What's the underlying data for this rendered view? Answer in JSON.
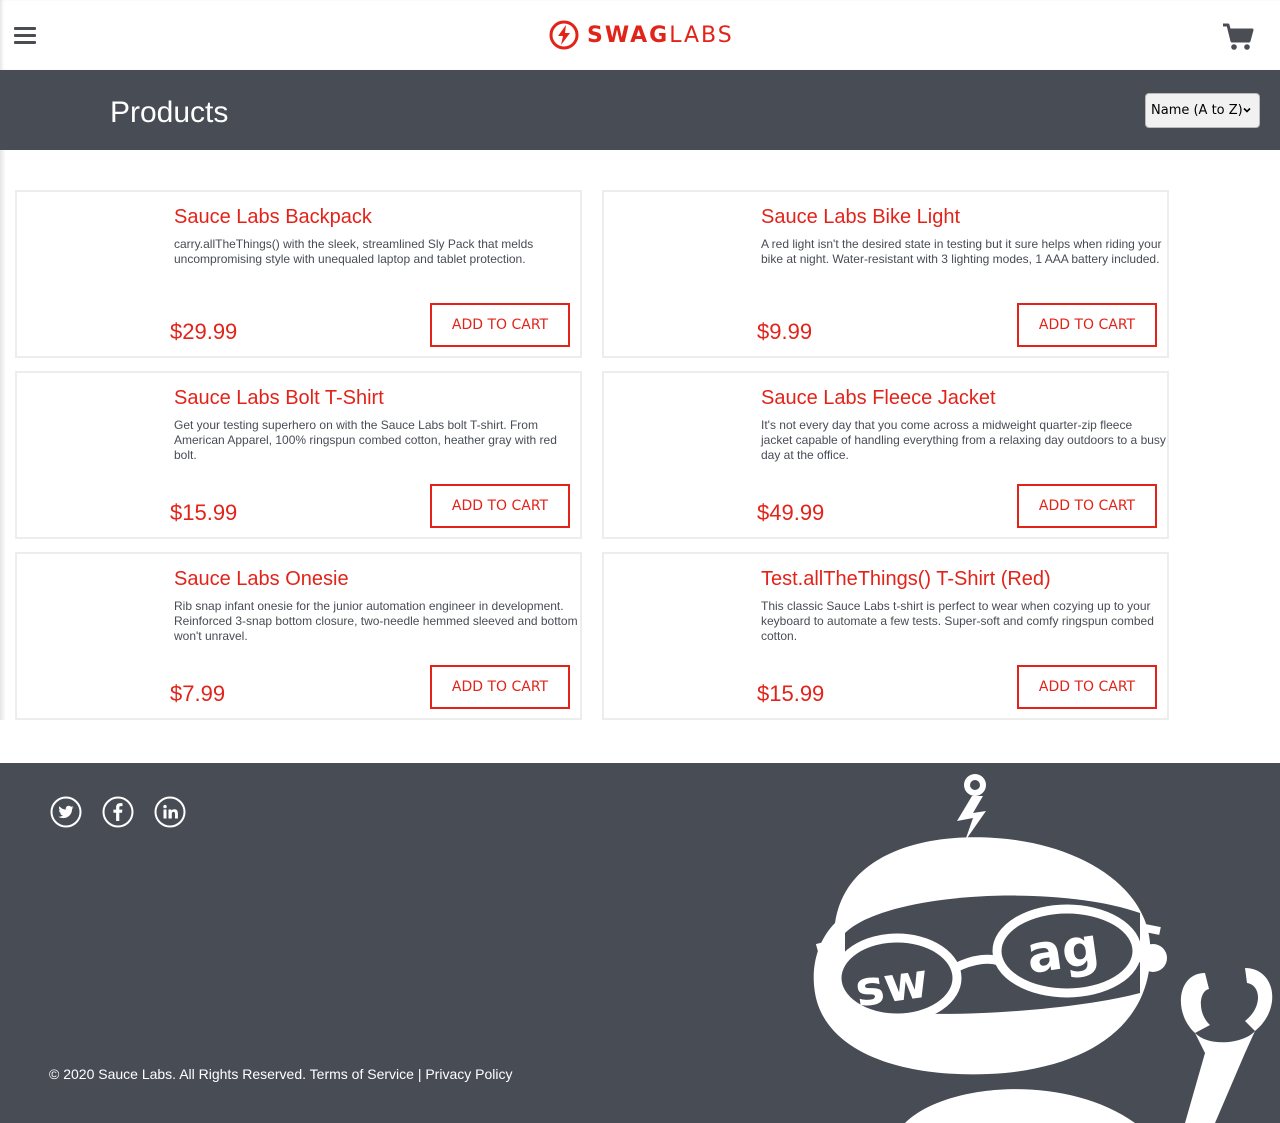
{
  "header": {
    "logo_bold": "SWAG",
    "logo_light": "LABS",
    "icons": {
      "menu": "hamburger-menu-icon",
      "cart": "shopping-cart-icon",
      "logo": "bolt-logo-icon"
    }
  },
  "subheader": {
    "title": "Products",
    "sort_selected": "Name (A to Z)"
  },
  "products": [
    {
      "name": "Sauce Labs Backpack",
      "description": "carry.allTheThings() with the sleek, streamlined Sly Pack that melds uncompromising style with unequaled laptop and tablet protection.",
      "price": "$29.99",
      "button": "ADD TO CART"
    },
    {
      "name": "Sauce Labs Bike Light",
      "description": "A red light isn't the desired state in testing but it sure helps when riding your bike at night. Water-resistant with 3 lighting modes, 1 AAA battery included.",
      "price": "$9.99",
      "button": "ADD TO CART"
    },
    {
      "name": "Sauce Labs Bolt T-Shirt",
      "description": "Get your testing superhero on with the Sauce Labs bolt T-shirt. From American Apparel, 100% ringspun combed cotton, heather gray with red bolt.",
      "price": "$15.99",
      "button": "ADD TO CART"
    },
    {
      "name": "Sauce Labs Fleece Jacket",
      "description": "It's not every day that you come across a midweight quarter-zip fleece jacket capable of handling everything from a relaxing day outdoors to a busy day at the office.",
      "price": "$49.99",
      "button": "ADD TO CART"
    },
    {
      "name": "Sauce Labs Onesie",
      "description": "Rib snap infant onesie for the junior automation engineer in development. Reinforced 3-snap bottom closure, two-needle hemmed sleeved and bottom won't unravel.",
      "price": "$7.99",
      "button": "ADD TO CART"
    },
    {
      "name": "Test.allTheThings() T-Shirt (Red)",
      "description": "This classic Sauce Labs t-shirt is perfect to wear when cozying up to your keyboard to automate a few tests. Super-soft and comfy ringspun combed cotton.",
      "price": "$15.99",
      "button": "ADD TO CART"
    }
  ],
  "footer": {
    "copyright": "© 2020 Sauce Labs. All Rights Reserved.",
    "terms": "Terms of Service",
    "separator": "|",
    "privacy": "Privacy Policy",
    "social_icons": [
      "twitter-icon",
      "facebook-icon",
      "linkedin-icon"
    ],
    "robot_text": "swag"
  },
  "colors": {
    "accent": "#e2231a",
    "dark": "#474c55",
    "text": "#484c55"
  }
}
